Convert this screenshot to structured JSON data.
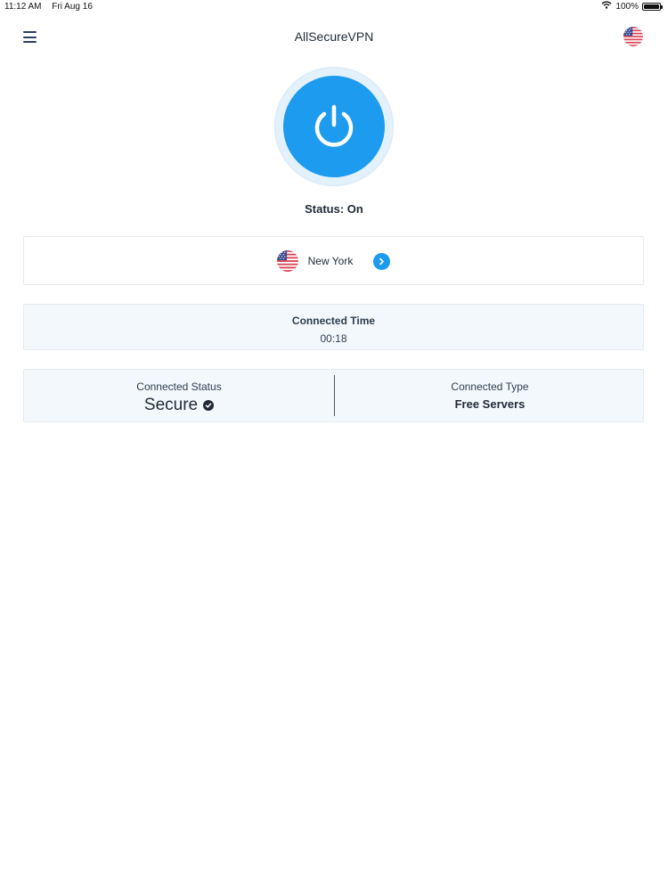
{
  "statusbar": {
    "time": "11:12 AM",
    "date": "Fri Aug 16",
    "battery": "100%"
  },
  "header": {
    "title": "AllSecureVPN",
    "menu_icon": "hamburger-menu-icon",
    "flag_icon": "us-flag-icon"
  },
  "power": {
    "icon": "power-icon",
    "status": "Status: On"
  },
  "location": {
    "name": "New York",
    "flag_icon": "us-flag-icon",
    "arrow_icon": "chevron-right-icon"
  },
  "connected_time": {
    "label": "Connected Time",
    "value": "00:18"
  },
  "connected_status": {
    "label": "Connected Status",
    "value": "Secure",
    "icon": "check-circle-icon"
  },
  "connected_type": {
    "label": "Connected Type",
    "value": "Free Servers"
  },
  "colors": {
    "accent": "#1c9bef",
    "text": "#1f2a37",
    "card_bg": "#f3f8fd"
  }
}
